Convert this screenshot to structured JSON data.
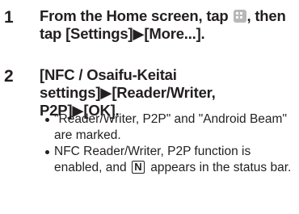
{
  "steps": [
    {
      "number": "1",
      "text_before_icon": "From the Home screen, tap ",
      "icon": "apps-grid-icon",
      "text_after_icon": ", then tap [Settings]▶[More...]."
    },
    {
      "number": "2",
      "text": "[NFC / Osaifu-Keitai settings]▶[Reader/Writer, P2P]▶[OK].",
      "bullets": [
        {
          "text": "\"Reader/Writer, P2P\" and \"Android Beam\" are marked."
        },
        {
          "text_before_icon": "NFC Reader/Writer, P2P function is enabled, and ",
          "icon": "nfc-status-icon",
          "icon_glyph": "N",
          "text_after_icon": " appears in the status bar."
        }
      ]
    }
  ]
}
